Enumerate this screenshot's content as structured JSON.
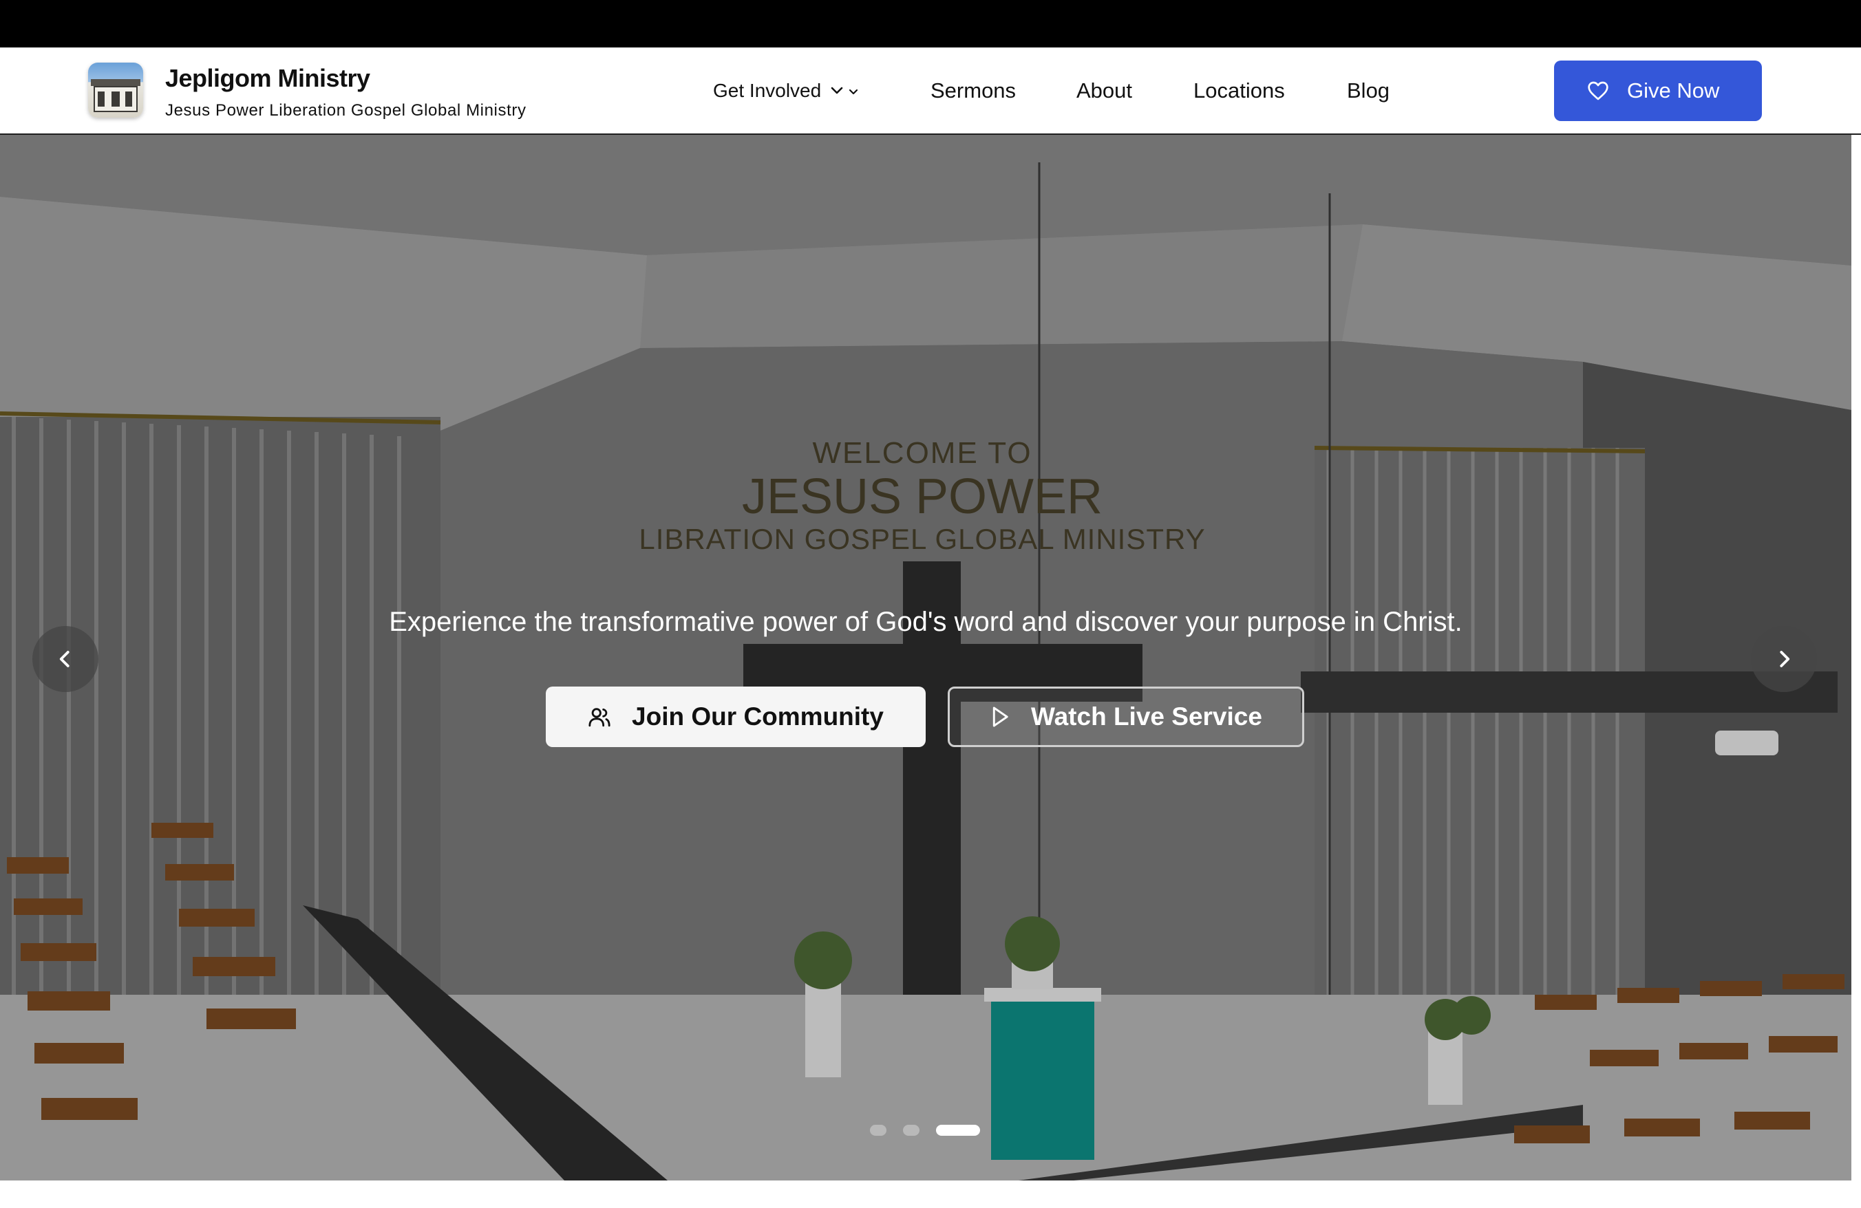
{
  "brand": {
    "title": "Jepligom Ministry",
    "subtitle": "Jesus Power Liberation Gospel Global Ministry"
  },
  "nav": {
    "get_involved": "Get Involved",
    "sermons": "Sermons",
    "about": "About",
    "locations": "Locations",
    "blog": "Blog"
  },
  "cta": {
    "give_now": "Give Now"
  },
  "hero": {
    "sign_line1": "WELCOME TO",
    "sign_line2": "JESUS POWER",
    "sign_line3": "LIBRATION GOSPEL GLOBAL MINISTRY",
    "tagline": "Experience the transformative power of God's word and discover your purpose in Christ.",
    "join_button": "Join Our Community",
    "watch_button": "Watch Live Service",
    "slides_total": 3,
    "active_slide": 3
  },
  "colors": {
    "accent": "#3457d9",
    "topbar": "#000000",
    "header_bg": "#ffffff"
  },
  "icons": {
    "logo": "church-building-logo",
    "dropdown": "chevron-down-icon",
    "give": "heart-icon",
    "join": "users-icon",
    "watch": "play-icon",
    "prev": "chevron-left-icon",
    "next": "chevron-right-icon"
  }
}
